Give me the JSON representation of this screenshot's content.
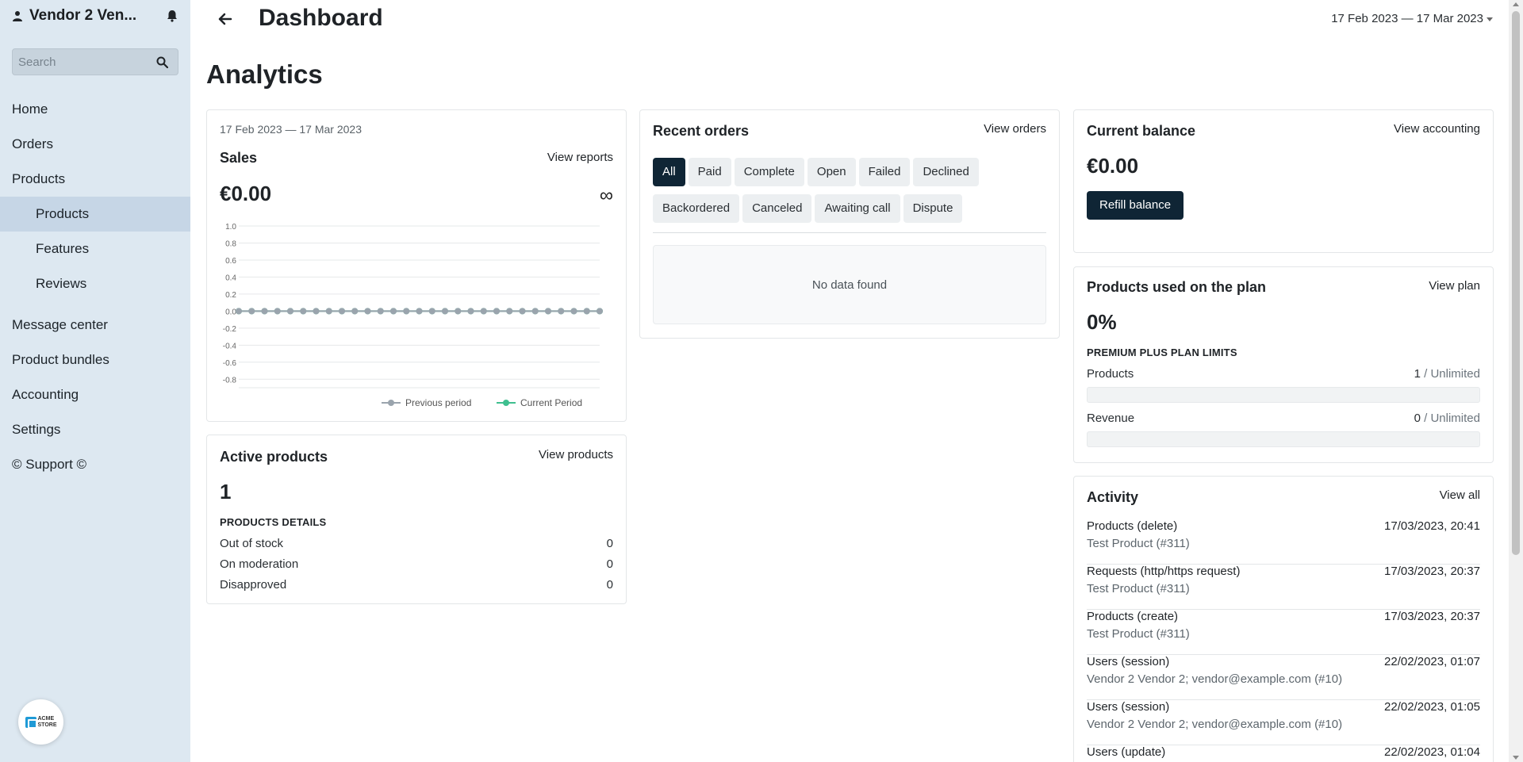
{
  "sidebar": {
    "vendor_name": "Vendor 2 Ven...",
    "search_placeholder": "Search",
    "nav": {
      "home": "Home",
      "orders": "Orders",
      "products": "Products",
      "products_sub": "Products",
      "features": "Features",
      "reviews": "Reviews",
      "message_center": "Message center",
      "product_bundles": "Product bundles",
      "accounting": "Accounting",
      "settings": "Settings",
      "support": "© Support ©"
    },
    "logo_line1": "ACME",
    "logo_line2": "STORE"
  },
  "header": {
    "title": "Dashboard",
    "date_range": "17 Feb 2023 — 17 Mar 2023"
  },
  "section_title": "Analytics",
  "sales": {
    "date_range": "17 Feb 2023 — 17 Mar 2023",
    "title": "Sales",
    "link": "View reports",
    "value": "€0.00",
    "change": "∞"
  },
  "chart_data": {
    "type": "line",
    "title": "",
    "xlabel": "",
    "ylabel": "",
    "ylim": [
      -0.9,
      1.0
    ],
    "yticks": [
      "1.0",
      "0.8",
      "0.6",
      "0.4",
      "0.2",
      "0.0",
      "-0.2",
      "-0.4",
      "-0.6",
      "-0.8"
    ],
    "x_count": 29,
    "legend_position": "bottom-right",
    "series": [
      {
        "name": "Previous period",
        "color": "#9aa4ad",
        "values": [
          0,
          0,
          0,
          0,
          0,
          0,
          0,
          0,
          0,
          0,
          0,
          0,
          0,
          0,
          0,
          0,
          0,
          0,
          0,
          0,
          0,
          0,
          0,
          0,
          0,
          0,
          0,
          0,
          0
        ]
      },
      {
        "name": "Current Period",
        "color": "#3fbf8f",
        "values": [
          0,
          0,
          0,
          0,
          0,
          0,
          0,
          0,
          0,
          0,
          0,
          0,
          0,
          0,
          0,
          0,
          0,
          0,
          0,
          0,
          0,
          0,
          0,
          0,
          0,
          0,
          0,
          0,
          0
        ]
      }
    ]
  },
  "active_products": {
    "title": "Active products",
    "link": "View products",
    "value": "1",
    "details_label": "PRODUCTS DETAILS",
    "rows": [
      {
        "label": "Out of stock",
        "value": "0"
      },
      {
        "label": "On moderation",
        "value": "0"
      },
      {
        "label": "Disapproved",
        "value": "0"
      }
    ]
  },
  "recent_orders": {
    "title": "Recent orders",
    "link": "View orders",
    "chips": [
      "All",
      "Paid",
      "Complete",
      "Open",
      "Failed",
      "Declined",
      "Backordered",
      "Canceled",
      "Awaiting call",
      "Dispute"
    ],
    "active_chip": "All",
    "empty_text": "No data found"
  },
  "balance": {
    "title": "Current balance",
    "link": "View accounting",
    "value": "€0.00",
    "button": "Refill balance"
  },
  "plan": {
    "title": "Products used on the plan",
    "link": "View plan",
    "value": "0%",
    "limits_label": "PREMIUM PLUS PLAN LIMITS",
    "products_label": "Products",
    "products_used": "1",
    "products_limit": " / Unlimited",
    "products_progress": 0,
    "revenue_label": "Revenue",
    "revenue_used": "0",
    "revenue_limit": " / Unlimited",
    "revenue_progress": 0
  },
  "activity": {
    "title": "Activity",
    "link": "View all",
    "items": [
      {
        "title": "Products (delete)",
        "sub": "Test Product (#311)",
        "time": "17/03/2023, 20:41"
      },
      {
        "title": "Requests (http/https request)",
        "sub": "Test Product (#311)",
        "time": "17/03/2023, 20:37"
      },
      {
        "title": "Products (create)",
        "sub": "Test Product (#311)",
        "time": "17/03/2023, 20:37"
      },
      {
        "title": "Users (session)",
        "sub": "Vendor 2 Vendor 2; vendor@example.com (#10)",
        "time": "22/02/2023, 01:07"
      },
      {
        "title": "Users (session)",
        "sub": "Vendor 2 Vendor 2; vendor@example.com (#10)",
        "time": "22/02/2023, 01:05"
      },
      {
        "title": "Users (update)",
        "sub": "",
        "time": "22/02/2023, 01:04"
      }
    ]
  }
}
